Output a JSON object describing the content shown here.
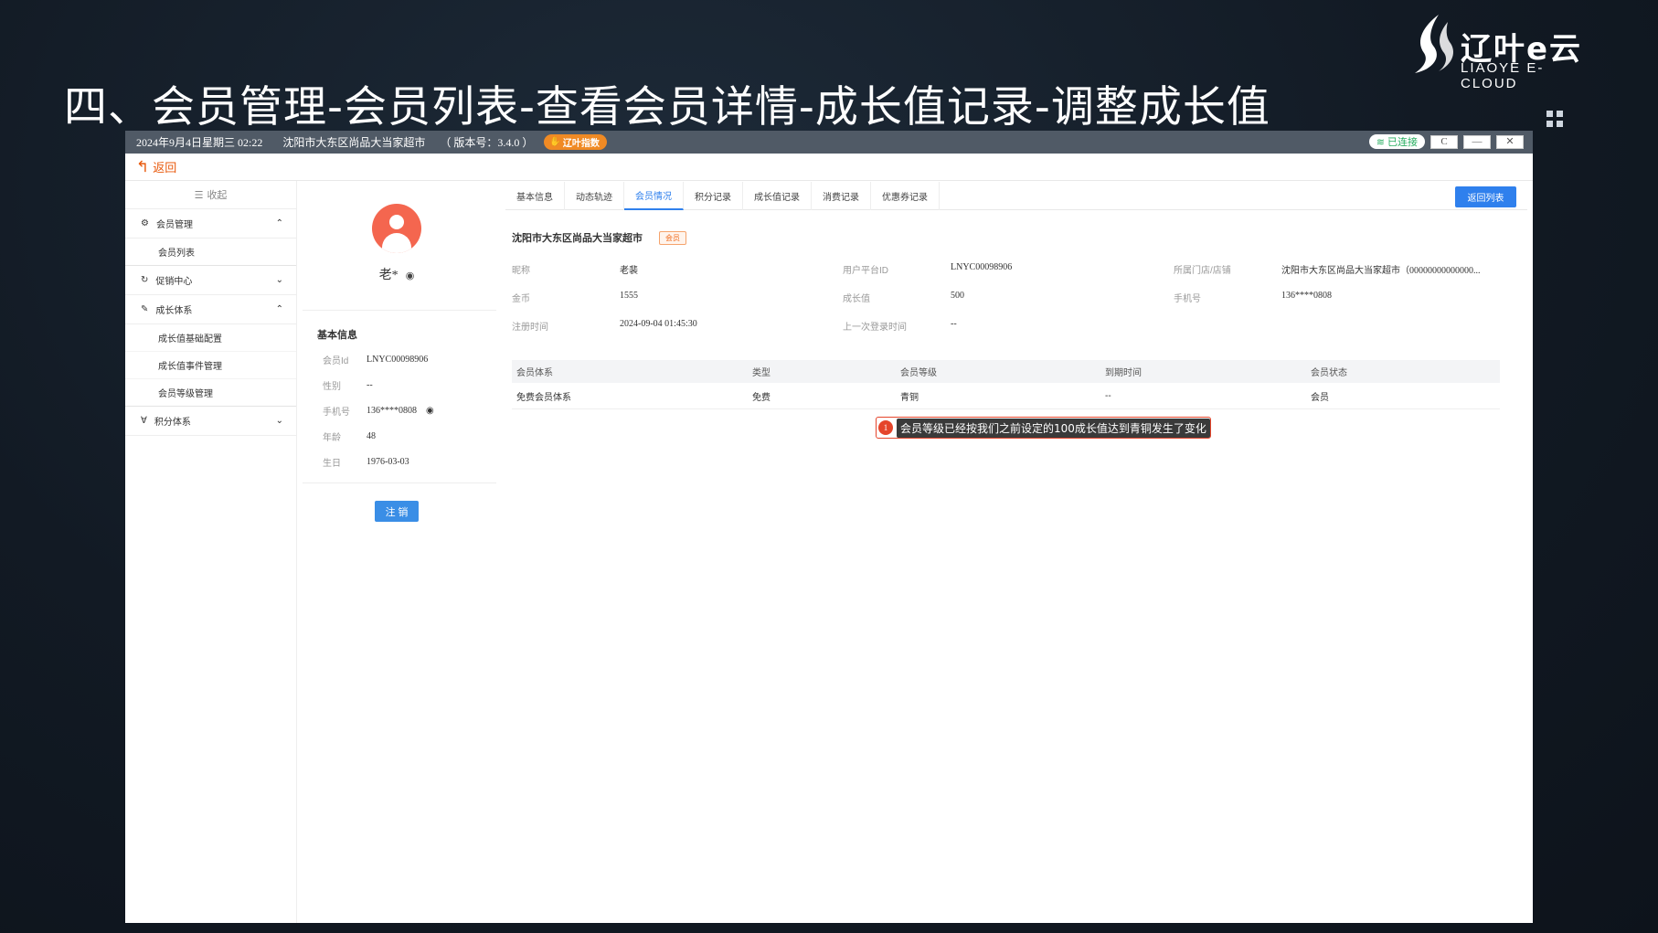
{
  "slide": {
    "title": "四、会员管理-会员列表-查看会员详情-成长值记录-调整成长值",
    "brand_cn": "辽叶e云",
    "brand_en": "LIAOYE E-CLOUD"
  },
  "titlebar": {
    "datetime": "2024年9月4日星期三 02:22",
    "store": "沈阳市大东区尚品大当家超市",
    "version": "（ 版本号：3.4.0 ）",
    "badge": "辽叶指数",
    "connection": "已连接",
    "refresh": "C",
    "minimize": "—",
    "close": "✕"
  },
  "backbar": {
    "label": "返回"
  },
  "sidebar": {
    "collapse": "收起",
    "groups": [
      {
        "label": "会员管理",
        "icon": "gear-icon",
        "expanded": true,
        "items": [
          "会员列表"
        ]
      },
      {
        "label": "促销中心",
        "icon": "refresh-icon",
        "expanded": false,
        "items": []
      },
      {
        "label": "成长体系",
        "icon": "growth-icon",
        "expanded": true,
        "items": [
          "成长值基础配置",
          "成长值事件管理",
          "会员等级管理"
        ]
      },
      {
        "label": "积分体系",
        "icon": "filter-icon",
        "expanded": false,
        "items": []
      }
    ]
  },
  "profile": {
    "name": "老*",
    "basic_title": "基本信息",
    "fields": [
      {
        "k": "会员Id",
        "v": "LNYC00098906"
      },
      {
        "k": "性别",
        "v": "--"
      },
      {
        "k": "手机号",
        "v": "136****0808"
      },
      {
        "k": "年龄",
        "v": "48"
      },
      {
        "k": "生日",
        "v": "1976-03-03"
      }
    ],
    "logout": "注 销"
  },
  "tabs": [
    "基本信息",
    "动态轨迹",
    "会员情况",
    "积分记录",
    "成长值记录",
    "消费记录",
    "优惠券记录"
  ],
  "active_tab": 2,
  "return_button": "返回列表",
  "store_info": {
    "name": "沈阳市大东区尚品大当家超市",
    "tag": "会员"
  },
  "info": {
    "nickname_k": "昵称",
    "nickname_v": "老裴",
    "platform_k": "用户平台ID",
    "platform_v": "LNYC00098906",
    "shop_k": "所属门店/店铺",
    "shop_v": "沈阳市大东区尚品大当家超市（00000000000000...",
    "coin_k": "金币",
    "coin_v": "1555",
    "growth_k": "成长值",
    "growth_v": "500",
    "phone_k": "手机号",
    "phone_v": "136****0808",
    "reg_k": "注册时间",
    "reg_v": "2024-09-04 01:45:30",
    "lastlogin_k": "上一次登录时间",
    "lastlogin_v": "--"
  },
  "table": {
    "headers": [
      "会员体系",
      "类型",
      "会员等级",
      "到期时间",
      "会员状态"
    ],
    "rows": [
      [
        "免费会员体系",
        "免费",
        "青铜",
        "--",
        "会员"
      ]
    ]
  },
  "callout": {
    "num": "1",
    "text": "会员等级已经按我们之前设定的100成长值达到青铜发生了变化"
  },
  "colors": {
    "accent": "#2f80ed",
    "back": "#e8590c",
    "avatar": "#f4664f",
    "callout": "#e5452b"
  }
}
